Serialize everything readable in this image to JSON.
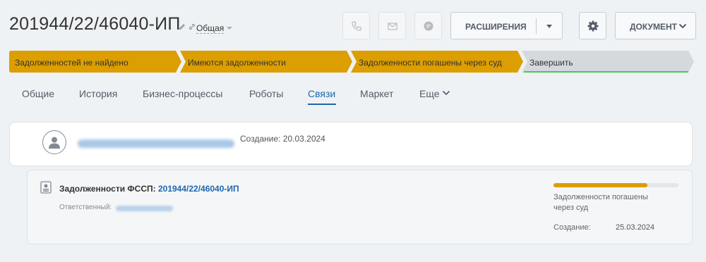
{
  "header": {
    "title": "201944/22/46040-ИП",
    "category": "Общая",
    "ext_button": "РАСШИРЕНИЯ",
    "doc_button": "ДОКУМЕНТ"
  },
  "stages": [
    {
      "label": "Задолженностей не найдено",
      "color": "#dc9e00"
    },
    {
      "label": "Имеются задолженности",
      "color": "#dc9e00"
    },
    {
      "label": "Задолженности погашены через суд",
      "color": "#dc9e00"
    },
    {
      "label": "Завершить",
      "color": "#d5d9dd",
      "underline": "#3bd04c"
    }
  ],
  "tabs": [
    {
      "label": "Общие"
    },
    {
      "label": "История"
    },
    {
      "label": "Бизнес-процессы"
    },
    {
      "label": "Роботы"
    },
    {
      "label": "Связи",
      "active": true
    },
    {
      "label": "Маркет"
    },
    {
      "label": "Еще"
    }
  ],
  "contact": {
    "created": "Создание: 20.03.2024"
  },
  "linked": {
    "title_prefix": "Задолженности ФССП:",
    "link": "201944/22/46040-ИП",
    "responsible_label": "Ответственный:",
    "progress": 0.75,
    "stage": "Задолженности погашены через суд",
    "created_label": "Создание:",
    "created_date": "25.03.2024"
  },
  "colors": {
    "accent": "#2067b0",
    "stage_active": "#dc9e00",
    "success": "#3bd04c"
  }
}
